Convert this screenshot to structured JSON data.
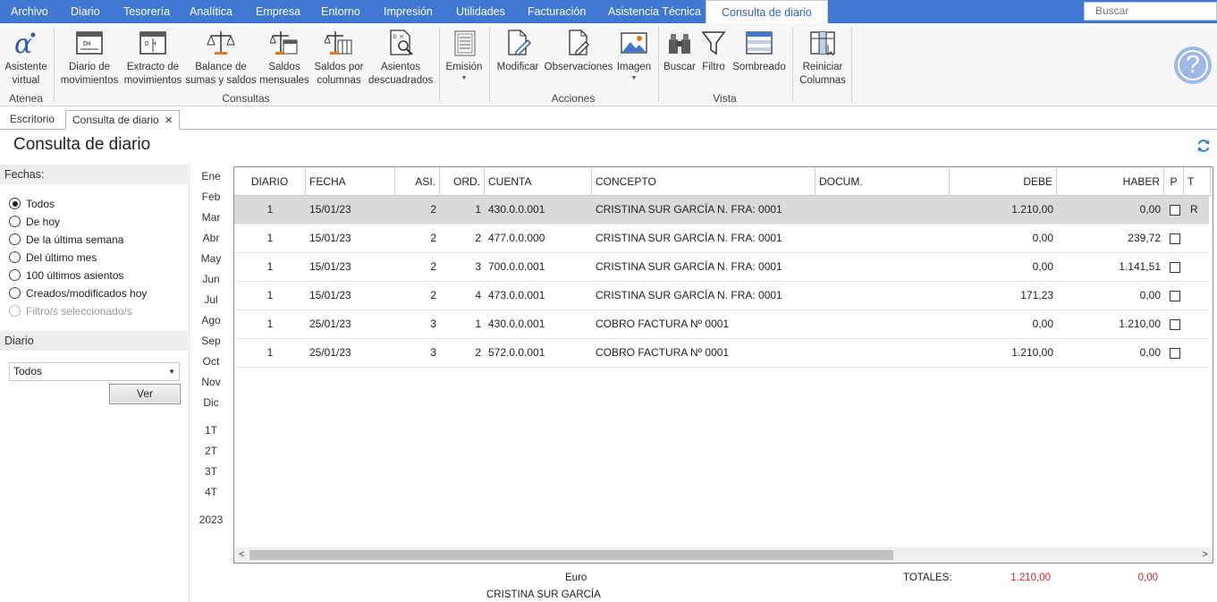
{
  "menu": {
    "tabs": [
      "Archivo",
      "Diario",
      "Tesorería",
      "Analítica",
      "Empresa",
      "Entorno",
      "Impresión",
      "Utilidades",
      "Facturación",
      "Asistencia Técnica",
      "Consulta de diario"
    ],
    "search_placeholder": "Buscar"
  },
  "ribbon": {
    "atenea": {
      "label1": "Asistente",
      "label2": "virtual",
      "group": "Atenea"
    },
    "consultas": {
      "group": "Consultas",
      "b1": {
        "l1": "Diario de",
        "l2": "movimientos"
      },
      "b2": {
        "l1": "Extracto de",
        "l2": "movimientos"
      },
      "b3": {
        "l1": "Balance de",
        "l2": "sumas y saldos"
      },
      "b4": {
        "l1": "Saldos",
        "l2": "mensuales"
      },
      "b5": {
        "l1": "Saldos por",
        "l2": "columnas"
      },
      "b6": {
        "l1": "Asientos",
        "l2": "descuadrados"
      }
    },
    "emision": "Emisión",
    "acciones": {
      "group": "Acciones",
      "modificar": "Modificar",
      "observaciones": "Observaciones",
      "imagen": "Imagen"
    },
    "vista": {
      "group": "Vista",
      "buscar": "Buscar",
      "filtro": "Filtro",
      "sombreado": "Sombreado"
    },
    "reiniciar": {
      "l1": "Reiniciar",
      "l2": "Columnas"
    }
  },
  "doctabs": {
    "escritorio": "Escritorio",
    "consulta": "Consulta de diario",
    "close": "✕"
  },
  "page_title": "Consulta de diario",
  "filters": {
    "fechas_label": "Fechas:",
    "options": [
      "Todos",
      "De hoy",
      "De la última semana",
      "Del último mes",
      "100 últimos asientos",
      "Creados/modificados hoy",
      "Filtro/s seleccionado/s"
    ],
    "selected": 0,
    "diario_label": "Diario",
    "diario_value": "Todos",
    "ver_label": "Ver"
  },
  "periods": {
    "months": [
      "Ene",
      "Feb",
      "Mar",
      "Abr",
      "May",
      "Jun",
      "Jul",
      "Ago",
      "Sep",
      "Oct",
      "Nov",
      "Dic"
    ],
    "quarters": [
      "1T",
      "2T",
      "3T",
      "4T"
    ],
    "year": "2023"
  },
  "table": {
    "headers": {
      "diario": "DIARIO",
      "fecha": "FECHA",
      "asi": "ASI.",
      "ord": "ORD.",
      "cuenta": "CUENTA",
      "concepto": "CONCEPTO",
      "docum": "DOCUM.",
      "debe": "DEBE",
      "haber": "HABER",
      "p": "P",
      "t": "T"
    },
    "rows": [
      {
        "diario": "1",
        "fecha": "15/01/23",
        "asi": "2",
        "ord": "1",
        "cuenta": "430.0.0.001",
        "concepto": "CRISTINA SUR GARCÍA N. FRA:  0001",
        "docum": "",
        "debe": "1.210,00",
        "haber": "0,00",
        "p": false,
        "t": "R"
      },
      {
        "diario": "1",
        "fecha": "15/01/23",
        "asi": "2",
        "ord": "2",
        "cuenta": "477.0.0.000",
        "concepto": "CRISTINA SUR GARCÍA N. FRA:  0001",
        "docum": "",
        "debe": "0,00",
        "haber": "239,72",
        "p": false,
        "t": ""
      },
      {
        "diario": "1",
        "fecha": "15/01/23",
        "asi": "2",
        "ord": "3",
        "cuenta": "700.0.0.001",
        "concepto": "CRISTINA SUR GARCÍA N. FRA:  0001",
        "docum": "",
        "debe": "0,00",
        "haber": "1.141,51",
        "p": false,
        "t": ""
      },
      {
        "diario": "1",
        "fecha": "15/01/23",
        "asi": "2",
        "ord": "4",
        "cuenta": "473.0.0.001",
        "concepto": "CRISTINA SUR GARCÍA N. FRA:  0001",
        "docum": "",
        "debe": "171,23",
        "haber": "0,00",
        "p": false,
        "t": ""
      },
      {
        "diario": "1",
        "fecha": "25/01/23",
        "asi": "3",
        "ord": "1",
        "cuenta": "430.0.0.001",
        "concepto": "COBRO FACTURA Nº 0001",
        "docum": "",
        "debe": "0,00",
        "haber": "1.210,00",
        "p": false,
        "t": ""
      },
      {
        "diario": "1",
        "fecha": "25/01/23",
        "asi": "3",
        "ord": "2",
        "cuenta": "572.0.0.001",
        "concepto": "COBRO FACTURA Nº 0001",
        "docum": "",
        "debe": "1.210,00",
        "haber": "0,00",
        "p": false,
        "t": ""
      }
    ]
  },
  "footer": {
    "currency": "Euro",
    "account_name": "CRISTINA SUR GARCÍA",
    "totales_label": "TOTALES:",
    "total_debe": "1.210,00",
    "total_haber": "0,00"
  },
  "colors": {
    "accent": "#3f78d3",
    "total": "#e02020"
  }
}
